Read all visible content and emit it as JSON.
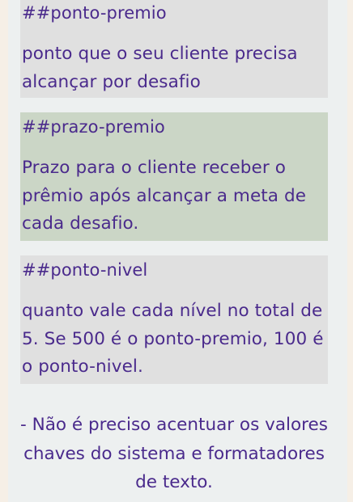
{
  "sections": [
    {
      "key": "##ponto-premio",
      "description": "ponto que o seu cliente precisa alcançar por desafio"
    },
    {
      "key": "##prazo-premio",
      "description": "Prazo para o cliente receber o prêmio após alcançar a meta de cada desafio."
    },
    {
      "key": "##ponto-nivel",
      "description": "quanto vale cada nível no total de 5. Se 500 é o ponto-premio, 100 é o ponto-nivel."
    }
  ],
  "note": "- Não é preciso acentuar os valores chaves do sistema e formatadores de texto.",
  "colors": {
    "text": "#4a2a8c",
    "gray_block": "#e0e0e0",
    "green_block": "#cbd6c6",
    "panel": "#edf0f0",
    "page": "#f6efe6"
  }
}
